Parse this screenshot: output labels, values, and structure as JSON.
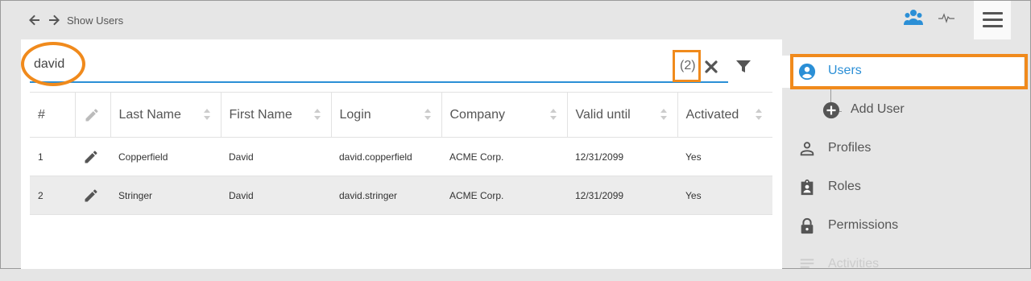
{
  "topbar": {
    "back_icon": "arrow-left-icon",
    "forward_icon": "arrow-right-icon",
    "breadcrumb": "Show Users",
    "users_icon": "users-group-icon",
    "activity_icon": "activity-pulse-icon",
    "menu_icon": "hamburger-menu-icon",
    "accent_color": "#2b8fd6"
  },
  "search": {
    "value": "david",
    "result_count": "(2)",
    "clear_icon": "close-icon",
    "filter_icon": "filter-icon"
  },
  "table": {
    "columns": [
      "#",
      "",
      "Last Name",
      "First Name",
      "Login",
      "Company",
      "Valid until",
      "Activated"
    ],
    "rows": [
      {
        "num": "1",
        "last": "Copperfield",
        "first": "David",
        "login": "david.copperfield",
        "company": "ACME Corp.",
        "valid": "12/31/2099",
        "activated": "Yes"
      },
      {
        "num": "2",
        "last": "Stringer",
        "first": "David",
        "login": "david.stringer",
        "company": "ACME Corp.",
        "valid": "12/31/2099",
        "activated": "Yes"
      }
    ]
  },
  "sidebar": {
    "items": [
      {
        "label": "Users",
        "icon": "account-circle-icon",
        "active": true
      },
      {
        "label": "Add User",
        "icon": "plus-circle-icon"
      },
      {
        "label": "Profiles",
        "icon": "person-outline-icon"
      },
      {
        "label": "Roles",
        "icon": "badge-icon"
      },
      {
        "label": "Permissions",
        "icon": "lock-icon"
      },
      {
        "label": "Activities",
        "icon": "list-icon"
      }
    ]
  },
  "highlight_color": "#f08a1c"
}
